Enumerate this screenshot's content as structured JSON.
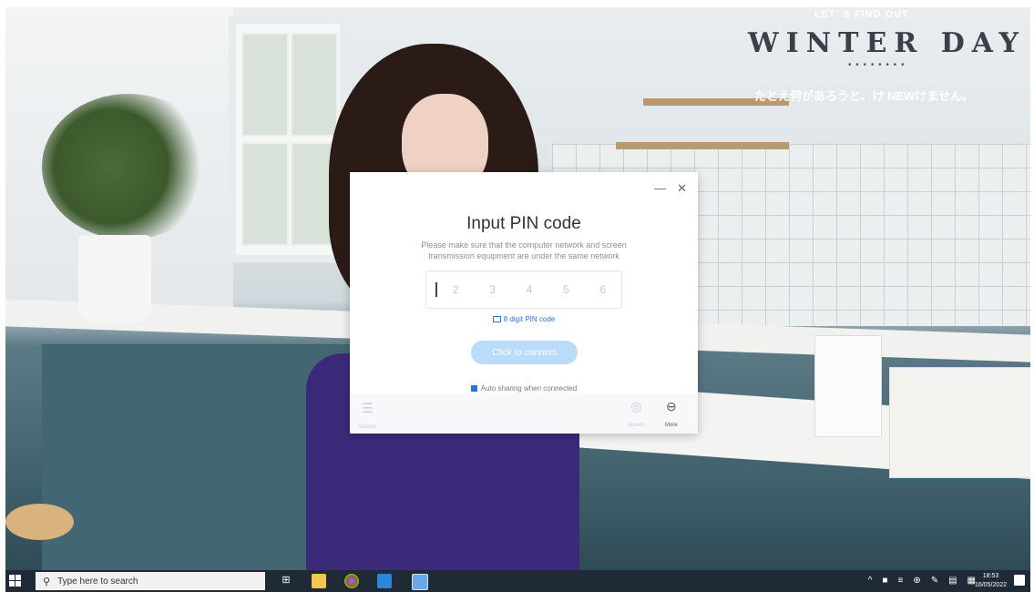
{
  "wallpaper": {
    "small_text": "LET' S FIND OUT",
    "big_text": "WINTER DAY",
    "dots": "• • • • • • • •",
    "japanese_line": "たとえ何があろうと、け NEWけません。"
  },
  "dialog": {
    "minimize_icon": "—",
    "close_icon": "✕",
    "title": "Input PIN code",
    "description": "Please make sure that the computer network and screen transmission equipment are under the same network",
    "pin_placeholder_cells": [
      "2",
      "3",
      "4",
      "5",
      "6"
    ],
    "pin_hint": "8 digit PIN code",
    "connect_button": "Click to connect",
    "auto_share": "Auto sharing when connected",
    "footer": {
      "left_label": "Screen",
      "middle_label": "Screen",
      "right_label": "More"
    }
  },
  "taskbar": {
    "search_placeholder": "Type here to search",
    "time": "18:53",
    "date": "16/05/2022"
  }
}
